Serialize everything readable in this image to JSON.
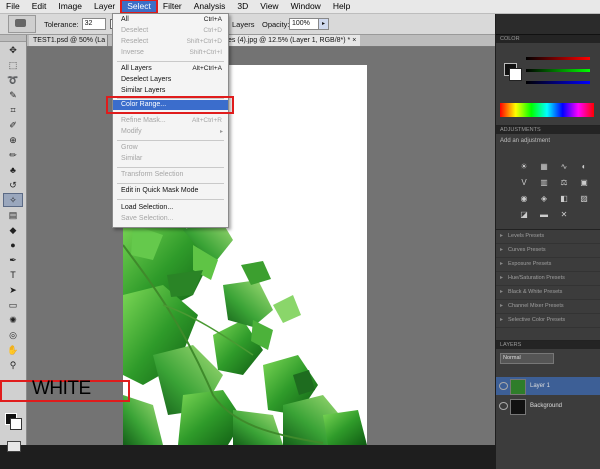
{
  "menubar": {
    "items": [
      "File",
      "Edit",
      "Image",
      "Layer",
      "Select",
      "Filter",
      "Analysis",
      "3D",
      "View",
      "Window",
      "Help"
    ],
    "active": "Select"
  },
  "options": {
    "tolerance_label": "Tolerance:",
    "tolerance_value": "32",
    "antialias_check": "✓",
    "antialias_letter": "A",
    "layers_label": "Layers",
    "opacity_label": "Opacity:",
    "opacity_value": "100%",
    "opacity_arrow": "▸"
  },
  "tabs": {
    "tab1": "TEST1.psd @ 50% (La",
    "tab2": "es (4).jpg @ 12.5% (Layer 1, RGB/8*) *",
    "close": "×"
  },
  "select_menu": [
    {
      "label": "All",
      "shortcut": "Ctrl+A",
      "disabled": false
    },
    {
      "label": "Deselect",
      "shortcut": "Ctrl+D",
      "disabled": true
    },
    {
      "label": "Reselect",
      "shortcut": "Shift+Ctrl+D",
      "disabled": true
    },
    {
      "label": "Inverse",
      "shortcut": "Shift+Ctrl+I",
      "disabled": true
    },
    {
      "label": "All Layers",
      "shortcut": "Alt+Ctrl+A",
      "disabled": false
    },
    {
      "label": "Deselect Layers",
      "shortcut": "",
      "disabled": false
    },
    {
      "label": "Similar Layers",
      "shortcut": "",
      "disabled": false
    },
    {
      "label": "Color Range...",
      "shortcut": "",
      "disabled": false,
      "highlighted": true
    },
    {
      "label": "Refine Mask...",
      "shortcut": "Alt+Ctrl+R",
      "disabled": true
    },
    {
      "label": "Modify",
      "shortcut": "",
      "disabled": true,
      "submenu_arrow": "▸"
    },
    {
      "label": "Grow",
      "shortcut": "",
      "disabled": true
    },
    {
      "label": "Similar",
      "shortcut": "",
      "disabled": true
    },
    {
      "label": "Transform Selection",
      "shortcut": "",
      "disabled": true
    },
    {
      "label": "Edit in Quick Mask Mode",
      "shortcut": "",
      "disabled": false
    },
    {
      "label": "Load Selection...",
      "shortcut": "",
      "disabled": false
    },
    {
      "label": "Save Selection...",
      "shortcut": "",
      "disabled": true
    }
  ],
  "annotation": {
    "white_label": "WHITE"
  },
  "right_panels": {
    "color_header": "COLOR",
    "adjustments_header": "ADJUSTMENTS",
    "adjustments_title": "Add an adjustment",
    "presets": [
      "Levels Presets",
      "Curves Presets",
      "Exposure Presets",
      "Hue/Saturation Presets",
      "Black & White Presets",
      "Channel Mixer Presets",
      "Selective Color Presets"
    ],
    "layers_header": "LAYERS",
    "blend_mode": "Normal",
    "layer_rows": [
      "Layer 1",
      "Background"
    ]
  },
  "colors": {
    "highlight": "#3b6dcc",
    "annotation_red": "#e01c1c",
    "leaf_green": "#2f9b2a"
  }
}
